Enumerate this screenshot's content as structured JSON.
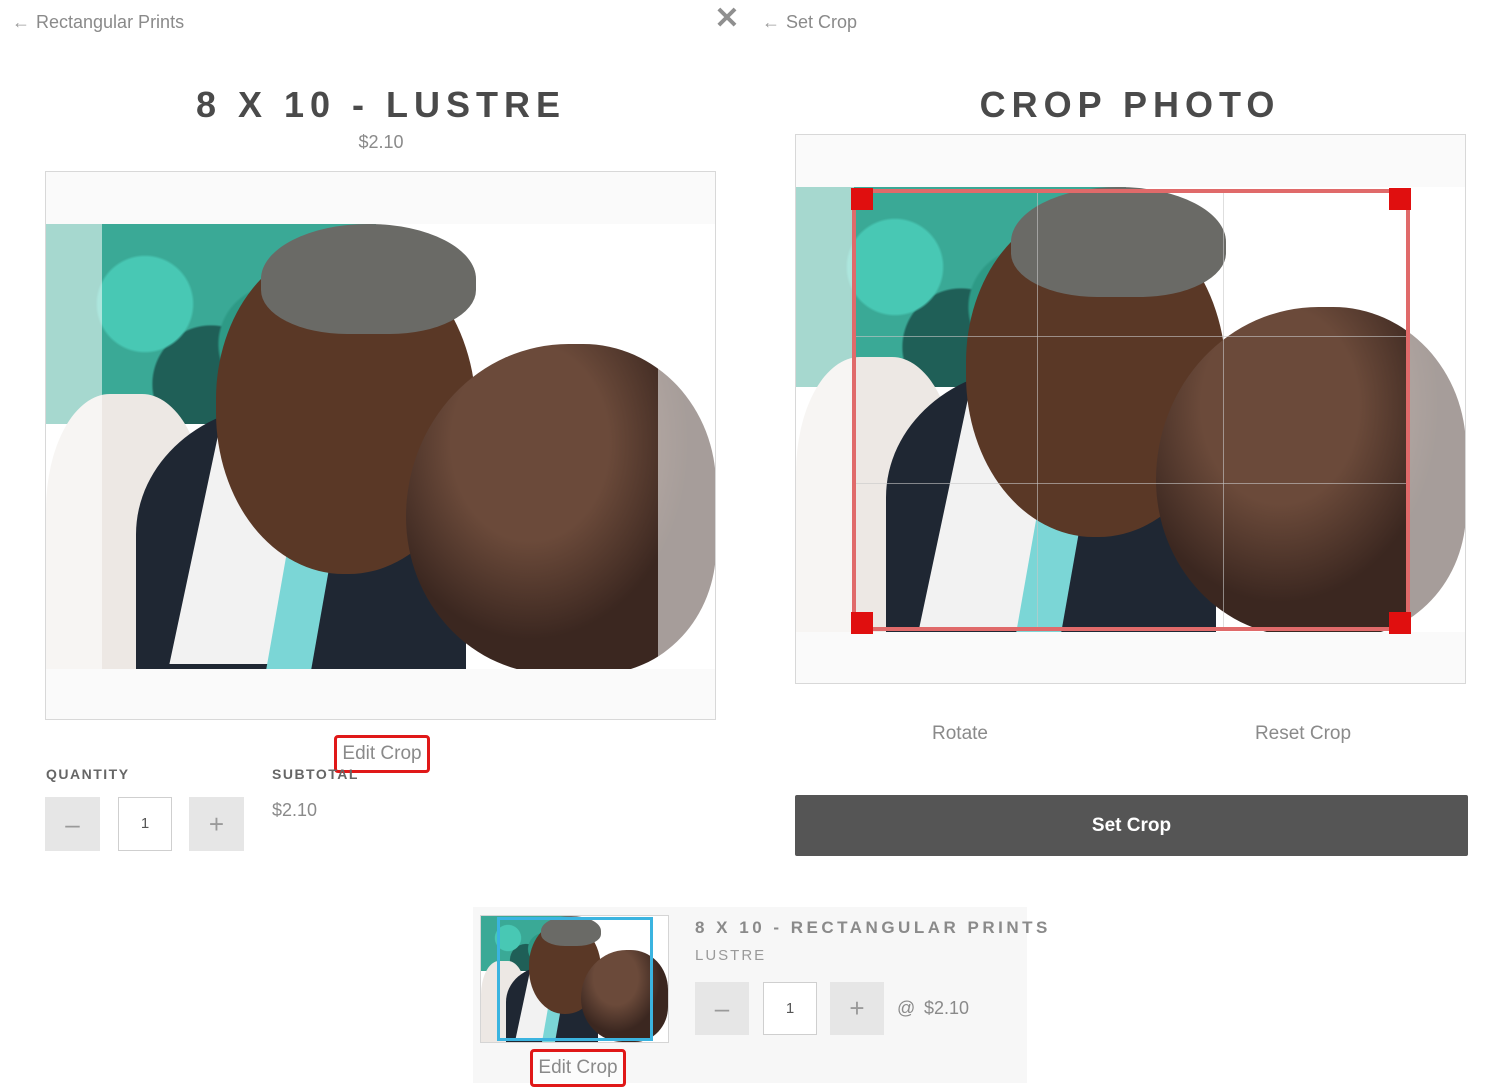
{
  "left": {
    "back_label": "Rectangular Prints",
    "title": "8 X 10 - LUSTRE",
    "price": "$2.10",
    "edit_crop_label": "Edit Crop",
    "quantity_label": "QUANTITY",
    "subtotal_label": "SUBTOTAL",
    "subtotal_value": "$2.10",
    "quantity_value": "1",
    "minus_label": "–",
    "plus_label": "+"
  },
  "close": {
    "label": "✕"
  },
  "right": {
    "back_label": "Set Crop",
    "title": "CROP PHOTO",
    "rotate_label": "Rotate",
    "reset_label": "Reset Crop",
    "set_crop_label": "Set Crop"
  },
  "cart": {
    "title": "8 X 10 - RECTANGULAR PRINTS",
    "finish": "LUSTRE",
    "quantity_value": "1",
    "minus_label": "–",
    "plus_label": "+",
    "at_symbol": "@",
    "unit_price": "$2.10",
    "edit_crop_label": "Edit Crop"
  },
  "colors": {
    "highlight": "#e01818",
    "crop_border": "#e06a6a",
    "crop_handle": "#e00f0f",
    "thumb_selection": "#3bb4e0",
    "primary_button": "#555555"
  },
  "icons": {
    "back": "arrow-left-icon",
    "close": "close-icon",
    "minus": "minus-icon",
    "plus": "plus-icon"
  }
}
